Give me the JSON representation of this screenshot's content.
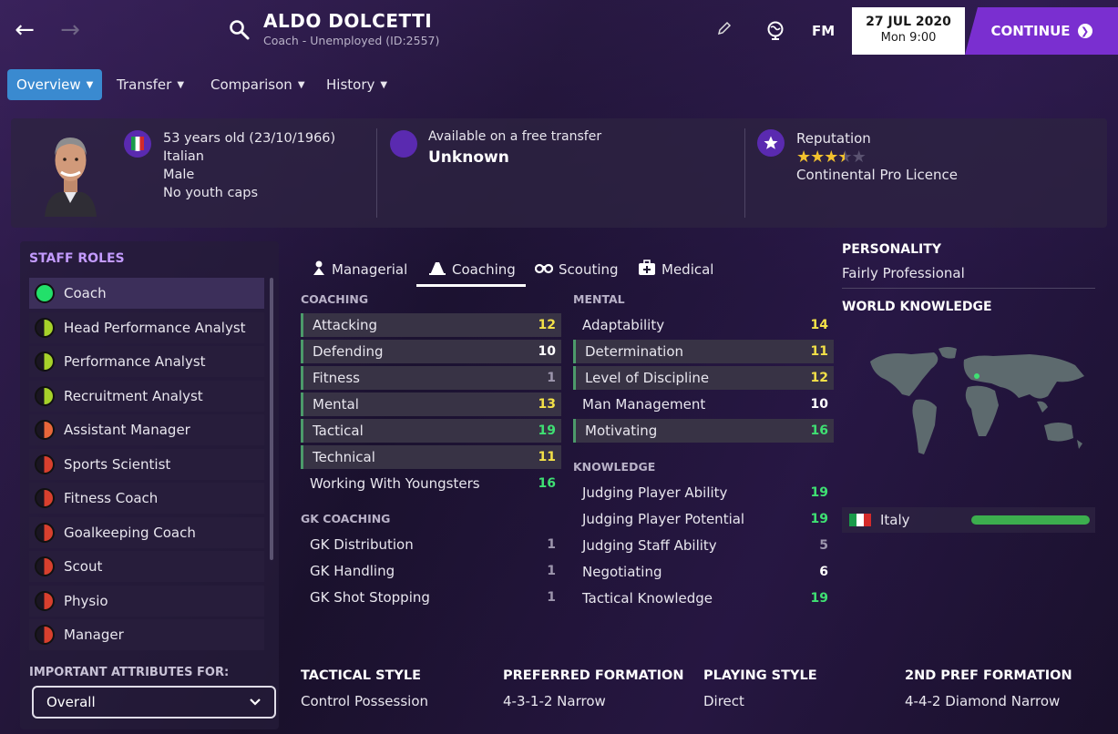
{
  "header": {
    "back_icon": "back-arrow-icon",
    "forward_icon": "forward-arrow-icon",
    "name": "ALDO DOLCETTI",
    "subtitle": "Coach - Unemployed (ID:2557)",
    "logo": "FM",
    "date": "27 JUL 2020",
    "time": "Mon 9:00",
    "continue_label": "CONTINUE"
  },
  "tabs": [
    {
      "label": "Overview"
    },
    {
      "label": "Transfer"
    },
    {
      "label": "Comparison"
    },
    {
      "label": "History"
    }
  ],
  "profile": {
    "age": "53 years old (23/10/1966)",
    "nationality": "Italian",
    "gender": "Male",
    "caps": "No youth caps",
    "transfer_label": "Available on a free transfer",
    "transfer_value": "Unknown",
    "reputation_label": "Reputation",
    "reputation_stars": 3.5,
    "reputation_max": 5,
    "licence": "Continental Pro Licence"
  },
  "staff_roles": {
    "title": "STAFF ROLES",
    "items": [
      {
        "label": "Coach",
        "color": "#22e06a"
      },
      {
        "label": "Head Performance Analyst",
        "color": "#a6d22a"
      },
      {
        "label": "Performance Analyst",
        "color": "#a6d22a"
      },
      {
        "label": "Recruitment Analyst",
        "color": "#a6d22a"
      },
      {
        "label": "Assistant Manager",
        "color": "#e8673a"
      },
      {
        "label": "Sports Scientist",
        "color": "#d8402e"
      },
      {
        "label": "Fitness Coach",
        "color": "#d8402e"
      },
      {
        "label": "Goalkeeping Coach",
        "color": "#d8402e"
      },
      {
        "label": "Scout",
        "color": "#d8402e"
      },
      {
        "label": "Physio",
        "color": "#d8402e"
      },
      {
        "label": "Manager",
        "color": "#d8402e"
      }
    ],
    "important_label": "IMPORTANT ATTRIBUTES FOR:",
    "select_value": "Overall"
  },
  "attr_tabs": [
    {
      "label": "Managerial",
      "icon": "managerial-icon"
    },
    {
      "label": "Coaching",
      "icon": "coaching-icon"
    },
    {
      "label": "Scouting",
      "icon": "binoculars-icon"
    },
    {
      "label": "Medical",
      "icon": "medical-kit-icon"
    }
  ],
  "coaching": {
    "title": "COACHING",
    "rows": [
      {
        "label": "Attacking",
        "value": "12"
      },
      {
        "label": "Defending",
        "value": "10"
      },
      {
        "label": "Fitness",
        "value": "1"
      },
      {
        "label": "Mental",
        "value": "13"
      },
      {
        "label": "Tactical",
        "value": "19"
      },
      {
        "label": "Technical",
        "value": "11"
      },
      {
        "label": "Working With Youngsters",
        "value": "16"
      }
    ]
  },
  "gk_coaching": {
    "title": "GK COACHING",
    "rows": [
      {
        "label": "GK Distribution",
        "value": "1"
      },
      {
        "label": "GK Handling",
        "value": "1"
      },
      {
        "label": "GK Shot Stopping",
        "value": "1"
      }
    ]
  },
  "mental": {
    "title": "MENTAL",
    "rows": [
      {
        "label": "Adaptability",
        "value": "14"
      },
      {
        "label": "Determination",
        "value": "11"
      },
      {
        "label": "Level of Discipline",
        "value": "12"
      },
      {
        "label": "Man Management",
        "value": "10"
      },
      {
        "label": "Motivating",
        "value": "16"
      }
    ]
  },
  "knowledge": {
    "title": "KNOWLEDGE",
    "rows": [
      {
        "label": "Judging Player Ability",
        "value": "19"
      },
      {
        "label": "Judging Player Potential",
        "value": "19"
      },
      {
        "label": "Judging Staff Ability",
        "value": "5"
      },
      {
        "label": "Negotiating",
        "value": "6"
      },
      {
        "label": "Tactical Knowledge",
        "value": "19"
      }
    ]
  },
  "personality": {
    "title": "PERSONALITY",
    "value": "Fairly Professional"
  },
  "world_knowledge": {
    "title": "WORLD KNOWLEDGE",
    "country": "Italy",
    "level": 1.0
  },
  "bottom": {
    "tactical_style_title": "TACTICAL STYLE",
    "tactical_style": "Control Possession",
    "preferred_formation_title": "PREFERRED FORMATION",
    "preferred_formation": "4-3-1-2 Narrow",
    "playing_style_title": "PLAYING STYLE",
    "playing_style": "Direct",
    "second_formation_title": "2ND PREF FORMATION",
    "second_formation": "4-4-2 Diamond Narrow"
  }
}
